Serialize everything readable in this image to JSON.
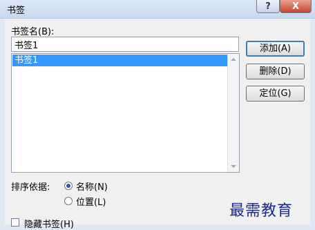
{
  "window": {
    "title": "书签"
  },
  "titlebar": {
    "help_label": "?",
    "close_label": "X"
  },
  "bookmark_name": {
    "label": "书签名(B):",
    "value": "书签1"
  },
  "bookmark_list": {
    "items": [
      "书签1"
    ],
    "selected_index": 0
  },
  "buttons": {
    "add": "添加(A)",
    "delete": "删除(D)",
    "goto": "定位(G)"
  },
  "sort": {
    "label": "排序依据:",
    "options": [
      "名称(N)",
      "位置(L)"
    ],
    "selected": "名称(N)"
  },
  "hidden_bookmarks": {
    "label": "隐藏书签(H)",
    "checked": false
  },
  "watermark": "最需教育"
}
